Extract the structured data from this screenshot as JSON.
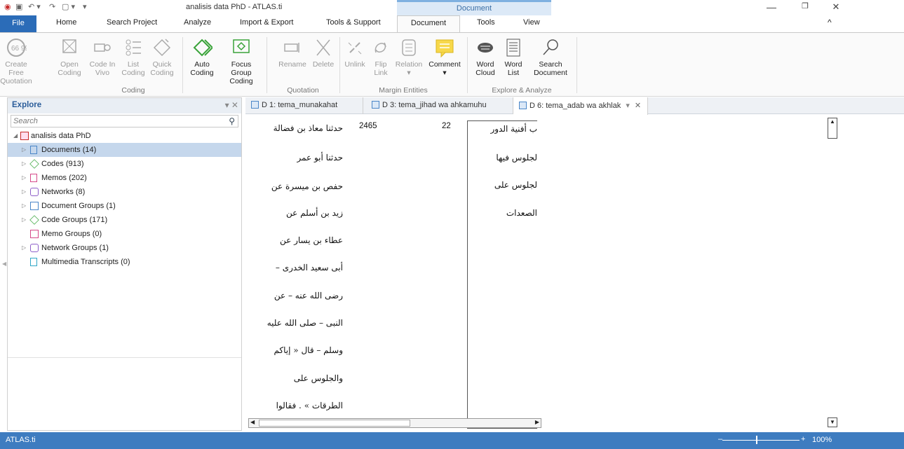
{
  "window": {
    "title": "analisis data PhD - ATLAS.ti",
    "context_tab": "Document",
    "minimize": "—",
    "restore": "❐",
    "close": "✕",
    "collapse": "^"
  },
  "ribbon_tabs": [
    "File",
    "Home",
    "Search Project",
    "Analyze",
    "Import & Export",
    "Tools & Support",
    "Document",
    "Tools",
    "View"
  ],
  "ribbon": {
    "create_free_quotation": [
      "Create Free",
      "Quotation"
    ],
    "open_coding": [
      "Open",
      "Coding"
    ],
    "code_in_vivo": [
      "Code In",
      "Vivo"
    ],
    "list_coding": [
      "List",
      "Coding"
    ],
    "quick_coding": [
      "Quick",
      "Coding"
    ],
    "auto_coding": [
      "Auto",
      "Coding"
    ],
    "focus_group_coding": [
      "Focus Group",
      "Coding"
    ],
    "rename": "Rename",
    "delete": "Delete",
    "unlink": "Unlink",
    "flip_link": [
      "Flip",
      "Link"
    ],
    "relation": "Relation",
    "comment": "Comment",
    "word_cloud": [
      "Word",
      "Cloud"
    ],
    "word_list": [
      "Word",
      "List"
    ],
    "search_document": [
      "Search",
      "Document"
    ],
    "groups": {
      "coding": "Coding",
      "quotation": "Quotation",
      "margin_entities": "Margin Entities",
      "explore_analyze": "Explore & Analyze"
    }
  },
  "explorer": {
    "title": "Explore",
    "search_placeholder": "Search",
    "project": "analisis data PhD",
    "items": [
      {
        "label": "Documents (14)",
        "color": "#4a86c8"
      },
      {
        "label": "Codes (913)",
        "color": "#4caf50"
      },
      {
        "label": "Memos (202)",
        "color": "#d64a8a"
      },
      {
        "label": "Networks (8)",
        "color": "#8e5fc9"
      },
      {
        "label": "Document Groups (1)",
        "color": "#4a86c8"
      },
      {
        "label": "Code Groups (171)",
        "color": "#4caf50"
      },
      {
        "label": "Memo Groups (0)",
        "color": "#d64a8a"
      },
      {
        "label": "Network Groups (1)",
        "color": "#8e5fc9"
      },
      {
        "label": "Multimedia Transcripts (0)",
        "color": "#2fa6c6"
      }
    ]
  },
  "doc_tabs": [
    {
      "label": "D 1: tema_munakahat"
    },
    {
      "label": "D 3: tema_jihad wa ahkamuhu"
    },
    {
      "label": "D 6: tema_adab wa akhlak"
    }
  ],
  "document": {
    "column1": [
      "حدثنا معاذ بن فضالة",
      "حدثنا أبو عمر",
      "حفص بن ميسرة عن",
      "زيد بن أسلم عن",
      "عطاء بن يسار عن",
      "أبى سعيد الخدرى –",
      "رضى الله عنه – عن",
      "النبى – صلى الله عليه",
      "وسلم – قال « إياكم",
      "والجلوس على",
      "الطرقات » . فقالوا"
    ],
    "num1": "2465",
    "num2": "22",
    "column2": [
      "ب أفنية الدور",
      "لجلوس فيها",
      "لجلوس على",
      "الصعدات"
    ]
  },
  "status": {
    "app": "ATLAS.ti",
    "zoom": "100%"
  }
}
